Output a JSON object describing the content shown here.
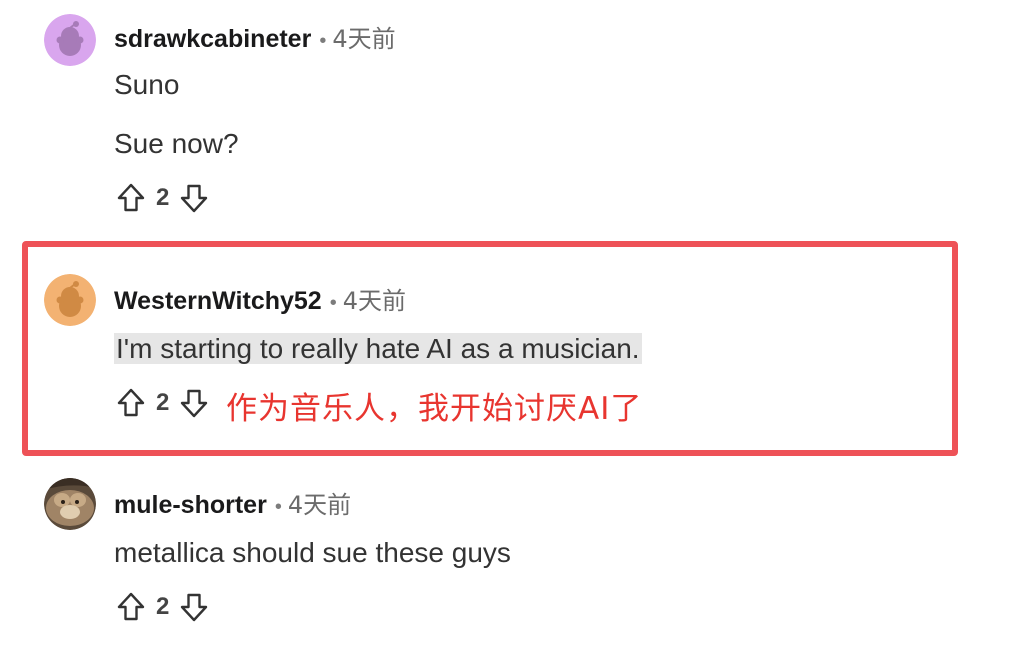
{
  "comments": [
    {
      "username": "sdrawkcabineter",
      "time": "4天前",
      "lines": [
        "Suno",
        "Sue now?"
      ],
      "votes": "2",
      "avatar_color": "#d9a6ee"
    },
    {
      "username": "WesternWitchy52",
      "time": "4天前",
      "lines": [
        "I'm starting to really hate AI as a musician."
      ],
      "votes": "2",
      "avatar_color": "#f3b272"
    },
    {
      "username": "mule-shorter",
      "time": "4天前",
      "lines": [
        "metallica should sue these guys"
      ],
      "votes": "2",
      "avatar_color": "#6a5a48"
    }
  ],
  "separator": "•",
  "annotation": {
    "text": "作为音乐人，我开始讨厌AI了",
    "color": "#e8352f"
  },
  "highlight_box_color": "#ee5257",
  "icons": {
    "upvote": "arrow-up-outline-icon",
    "downvote": "arrow-down-outline-icon"
  }
}
